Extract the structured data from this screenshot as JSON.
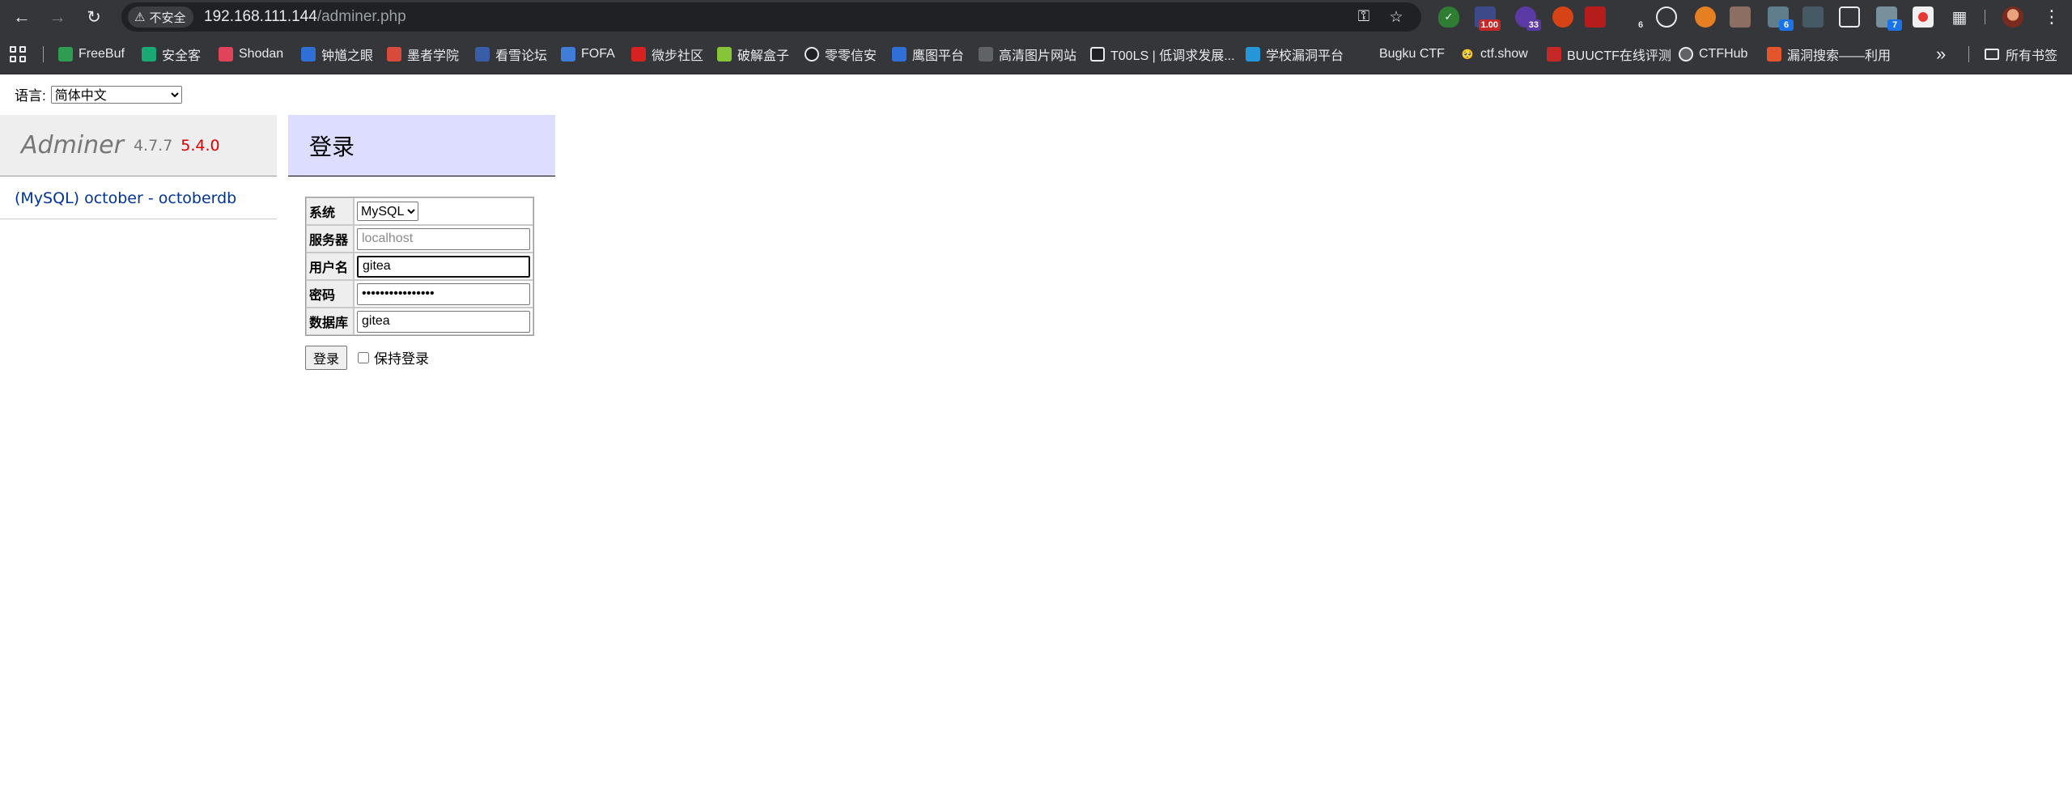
{
  "browser": {
    "security_label": "不安全",
    "url_host": "192.168.111.144",
    "url_path": "/adminer.php",
    "bookmarks": [
      {
        "label": "FreeBuf",
        "color": "#2e9d52"
      },
      {
        "label": "安全客",
        "color": "#19a974"
      },
      {
        "label": "Shodan",
        "color": "#e0445a"
      },
      {
        "label": "钟馗之眼",
        "color": "#2f6fd6"
      },
      {
        "label": "墨者学院",
        "color": "#d84a3b"
      },
      {
        "label": "看雪论坛",
        "color": "#3a5da8"
      },
      {
        "label": "FOFA",
        "color": "#3f7dd8"
      },
      {
        "label": "微步社区",
        "color": "#d82222"
      },
      {
        "label": "破解盒子",
        "color": "#86c43a"
      },
      {
        "label": "零零信安",
        "color": "#202124"
      },
      {
        "label": "鹰图平台",
        "color": "#2e6fd8"
      },
      {
        "label": "高清图片网站",
        "color": "#5f6368"
      },
      {
        "label": "T00LS | 低调求发展...",
        "color": "#202124"
      },
      {
        "label": "学校漏洞平台",
        "color": "#2596d8"
      },
      {
        "label": "Bugku CTF",
        "color": "#35363a"
      },
      {
        "label": "ctf.show",
        "color": "#35363a"
      },
      {
        "label": "BUUCTF在线评测",
        "color": "#c62828"
      },
      {
        "label": "CTFHub",
        "color": "#5f6368"
      },
      {
        "label": "漏洞搜索——利用",
        "color": "#e2552d"
      }
    ],
    "all_bookmarks_label": "所有书签",
    "extensions": {
      "badge_1": "1.00",
      "badge_2": "33",
      "badge_3": "6",
      "badge_4": "6",
      "badge_5": "7"
    },
    "accent_color": "#35363a"
  },
  "page": {
    "language_label": "语言:",
    "language_selected": "简体中文",
    "logo": {
      "name": "Adminer",
      "version": "4.7.7",
      "new_version": "5.4.0"
    },
    "db_link": "(MySQL) october - octoberdb",
    "heading": "登录",
    "form": {
      "system_label": "系统",
      "system_value": "MySQL",
      "server_label": "服务器",
      "server_placeholder": "localhost",
      "username_label": "用户名",
      "username_value": "gitea",
      "password_label": "密码",
      "password_value": "••••••••••••••••",
      "database_label": "数据库",
      "database_value": "gitea"
    },
    "login_button": "登录",
    "remember_label": "保持登录"
  }
}
